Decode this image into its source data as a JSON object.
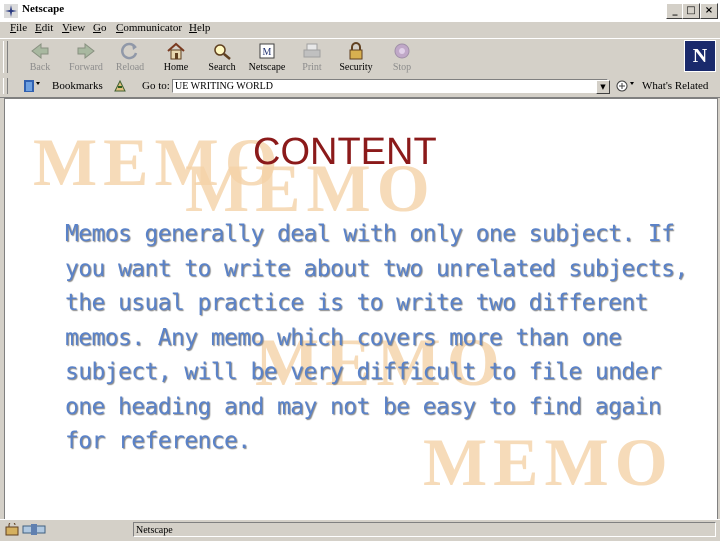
{
  "window": {
    "title": "Netscape",
    "min": "_",
    "max": "□",
    "close": "×"
  },
  "menu": [
    {
      "label": "File",
      "ul": "F",
      "rest": "ile"
    },
    {
      "label": "Edit",
      "ul": "E",
      "rest": "dit"
    },
    {
      "label": "View",
      "ul": "V",
      "rest": "iew"
    },
    {
      "label": "Go",
      "ul": "G",
      "rest": "o"
    },
    {
      "label": "Communicator",
      "ul": "C",
      "rest": "ommunicator"
    },
    {
      "label": "Help",
      "ul": "H",
      "rest": "elp"
    }
  ],
  "toolbar": {
    "back": "Back",
    "forward": "Forward",
    "reload": "Reload",
    "home": "Home",
    "search": "Search",
    "netscape": "Netscape",
    "print": "Print",
    "security": "Security",
    "stop": "Stop"
  },
  "location": {
    "bookmarks": "Bookmarks",
    "goto": "Go to:",
    "value": "UE WRITING WORLD",
    "related": "What's Related"
  },
  "page": {
    "heading": "CONTENT",
    "body": "Memos generally deal with only one subject. If you want to write about two unrelated subjects, the usual practice is to write two different memos. Any memo which covers more than one subject, will be very difficult to file under one heading and may not be easy to find again for reference.",
    "watermark": "MEMO"
  },
  "status": {
    "text": "Netscape"
  },
  "colors": {
    "heading": "#8b1a1a",
    "body_text": "#5a82c8",
    "watermark": "#f5d3a8",
    "chrome": "#d4d0c8"
  }
}
